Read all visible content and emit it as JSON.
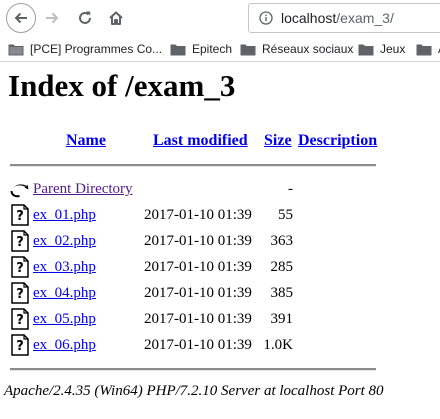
{
  "browser": {
    "url_host": "localhost",
    "url_path": "/exam_3/",
    "bookmarks": [
      {
        "label": "[PCE] Programmes Co..."
      },
      {
        "label": "Epitech"
      },
      {
        "label": "Réseaux sociaux"
      },
      {
        "label": "Jeux"
      },
      {
        "label": "A"
      }
    ]
  },
  "page": {
    "title": "Index of /exam_3",
    "columns": {
      "name": "Name",
      "last_modified": "Last modified",
      "size": "Size",
      "description": "Description"
    },
    "parent": {
      "name": "Parent Directory",
      "size": "-"
    },
    "files": [
      {
        "name": "ex_01.php",
        "modified": "2017-01-10 01:39",
        "size": "55"
      },
      {
        "name": "ex_02.php",
        "modified": "2017-01-10 01:39",
        "size": "363"
      },
      {
        "name": "ex_03.php",
        "modified": "2017-01-10 01:39",
        "size": "285"
      },
      {
        "name": "ex_04.php",
        "modified": "2017-01-10 01:39",
        "size": "385"
      },
      {
        "name": "ex_05.php",
        "modified": "2017-01-10 01:39",
        "size": "391"
      },
      {
        "name": "ex_06.php",
        "modified": "2017-01-10 01:39",
        "size": "1.0K"
      }
    ],
    "footer": "Apache/2.4.35 (Win64) PHP/7.2.10 Server at localhost Port 80"
  },
  "colors": {
    "link": "#0000ee",
    "visited_link": "#551a8b"
  }
}
